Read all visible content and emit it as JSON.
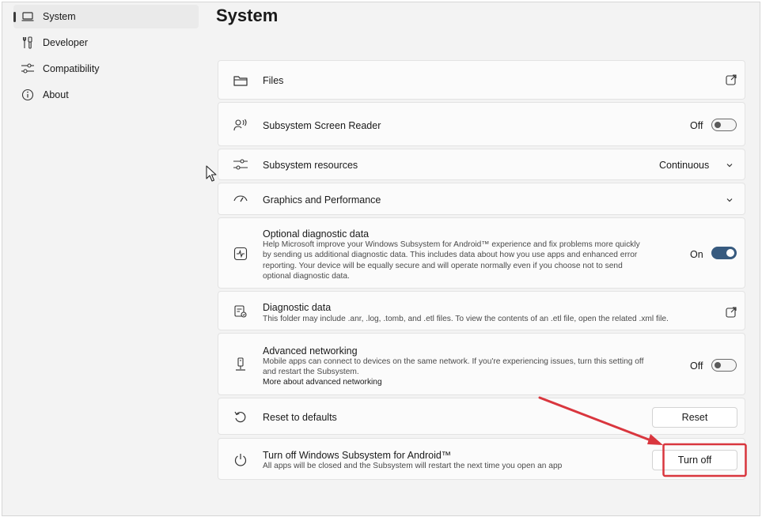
{
  "sidebar": {
    "items": [
      {
        "label": "System",
        "icon": "laptop-icon",
        "active": true
      },
      {
        "label": "Developer",
        "icon": "tools-icon"
      },
      {
        "label": "Compatibility",
        "icon": "sliders-icon"
      },
      {
        "label": "About",
        "icon": "info-icon"
      }
    ]
  },
  "page": {
    "title": "System"
  },
  "settings": {
    "files": {
      "title": "Files"
    },
    "screen_reader": {
      "title": "Subsystem Screen Reader",
      "state": "Off"
    },
    "resources": {
      "title": "Subsystem resources",
      "value": "Continuous"
    },
    "graphics": {
      "title": "Graphics and Performance"
    },
    "optional_diag": {
      "title": "Optional diagnostic data",
      "description": "Help Microsoft improve your Windows Subsystem for Android™ experience and fix problems more quickly by sending us additional diagnostic data. This includes data about how you use apps and enhanced error reporting. Your device will be equally secure and will operate normally even if you choose not to send optional diagnostic data.",
      "state": "On"
    },
    "diag_data": {
      "title": "Diagnostic data",
      "description": "This folder may include .anr, .log, .tomb, and .etl files. To view the contents of an .etl file, open the related .xml file."
    },
    "adv_net": {
      "title": "Advanced networking",
      "description": "Mobile apps can connect to devices on the same network. If you're experiencing issues, turn this setting off and restart the Subsystem.",
      "link": "More about advanced networking",
      "state": "Off"
    },
    "reset": {
      "title": "Reset to defaults",
      "button": "Reset"
    },
    "turn_off": {
      "title": "Turn off Windows Subsystem for Android™",
      "description": "All apps will be closed and the Subsystem will restart the next time you open an app",
      "button": "Turn off"
    }
  },
  "annotation_color": "#d9363e"
}
